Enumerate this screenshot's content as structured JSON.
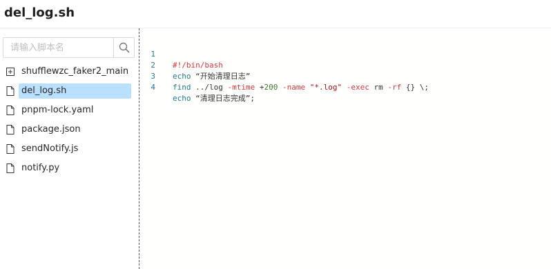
{
  "header": {
    "title": "del_log.sh"
  },
  "sidebar": {
    "search": {
      "placeholder": "请输入脚本名",
      "value": ""
    },
    "items": [
      {
        "label": "shufflewzc_faker2_main",
        "icon": "folder-plus-icon",
        "selected": false
      },
      {
        "label": "del_log.sh",
        "icon": "file-icon",
        "selected": true
      },
      {
        "label": "pnpm-lock.yaml",
        "icon": "file-icon",
        "selected": false
      },
      {
        "label": "package.json",
        "icon": "file-icon",
        "selected": false
      },
      {
        "label": "sendNotify.js",
        "icon": "file-icon",
        "selected": false
      },
      {
        "label": "notify.py",
        "icon": "file-icon",
        "selected": false
      }
    ]
  },
  "editor": {
    "lines": [
      {
        "number": "1",
        "tokens": [
          {
            "t": "#!/bin/bash",
            "c": "comment"
          }
        ]
      },
      {
        "number": "2",
        "tokens": [
          {
            "t": "echo",
            "c": "cmd"
          },
          {
            "t": " “开始清理日志”",
            "c": "plain"
          }
        ]
      },
      {
        "number": "3",
        "tokens": [
          {
            "t": "find",
            "c": "cmd"
          },
          {
            "t": " ../log ",
            "c": "plain"
          },
          {
            "t": "-mtime",
            "c": "flag"
          },
          {
            "t": " +",
            "c": "plain"
          },
          {
            "t": "200",
            "c": "num"
          },
          {
            "t": " ",
            "c": "plain"
          },
          {
            "t": "-name",
            "c": "flag"
          },
          {
            "t": " ",
            "c": "plain"
          },
          {
            "t": "\"*.log\"",
            "c": "str"
          },
          {
            "t": " ",
            "c": "plain"
          },
          {
            "t": "-exec",
            "c": "flag"
          },
          {
            "t": " rm ",
            "c": "plain"
          },
          {
            "t": "-rf",
            "c": "flag"
          },
          {
            "t": " {} \\;",
            "c": "plain"
          }
        ]
      },
      {
        "number": "4",
        "tokens": [
          {
            "t": "echo",
            "c": "cmd"
          },
          {
            "t": " “清理日志完成”;",
            "c": "plain"
          }
        ]
      }
    ]
  },
  "colors": {
    "selected_bg": "#bae0ff",
    "line_number": "#237893",
    "keyword_red": "#d13a3a",
    "command_teal": "#1f7a8c"
  }
}
